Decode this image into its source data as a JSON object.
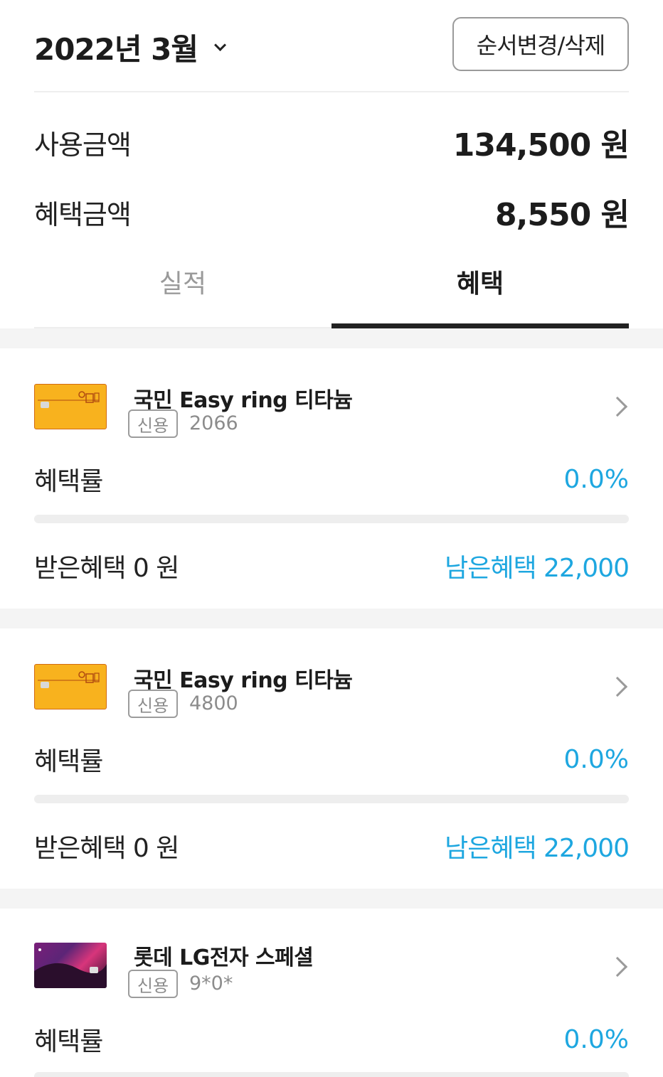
{
  "header": {
    "month": "2022년 3월",
    "reorder_button": "순서변경/삭제"
  },
  "summary": {
    "usage_label": "사용금액",
    "usage_value": "134,500 원",
    "benefit_label": "혜택금액",
    "benefit_value": "8,550 원"
  },
  "tabs": [
    {
      "label": "실적",
      "active": false
    },
    {
      "label": "혜택",
      "active": true
    }
  ],
  "colors": {
    "accent_blue": "#1ea7e0",
    "card_yellow": "#f8b21e",
    "card_purple": "#7a1e79"
  },
  "cards": [
    {
      "name": "국민 Easy ring 티타늄",
      "type": "신용",
      "number": "2066",
      "thumb": "yellow",
      "rate_label": "혜택률",
      "rate": "0.0%",
      "progress": 0,
      "received": "받은혜택 0 원",
      "remaining": "남은혜택 22,000"
    },
    {
      "name": "국민 Easy ring 티타늄",
      "type": "신용",
      "number": "4800",
      "thumb": "yellow",
      "rate_label": "혜택률",
      "rate": "0.0%",
      "progress": 0,
      "received": "받은혜택 0 원",
      "remaining": "남은혜택 22,000"
    },
    {
      "name": "롯데 LG전자 스페셜",
      "type": "신용",
      "number": "9*0*",
      "thumb": "purple",
      "rate_label": "혜택률",
      "rate": "0.0%",
      "progress": 0
    }
  ]
}
